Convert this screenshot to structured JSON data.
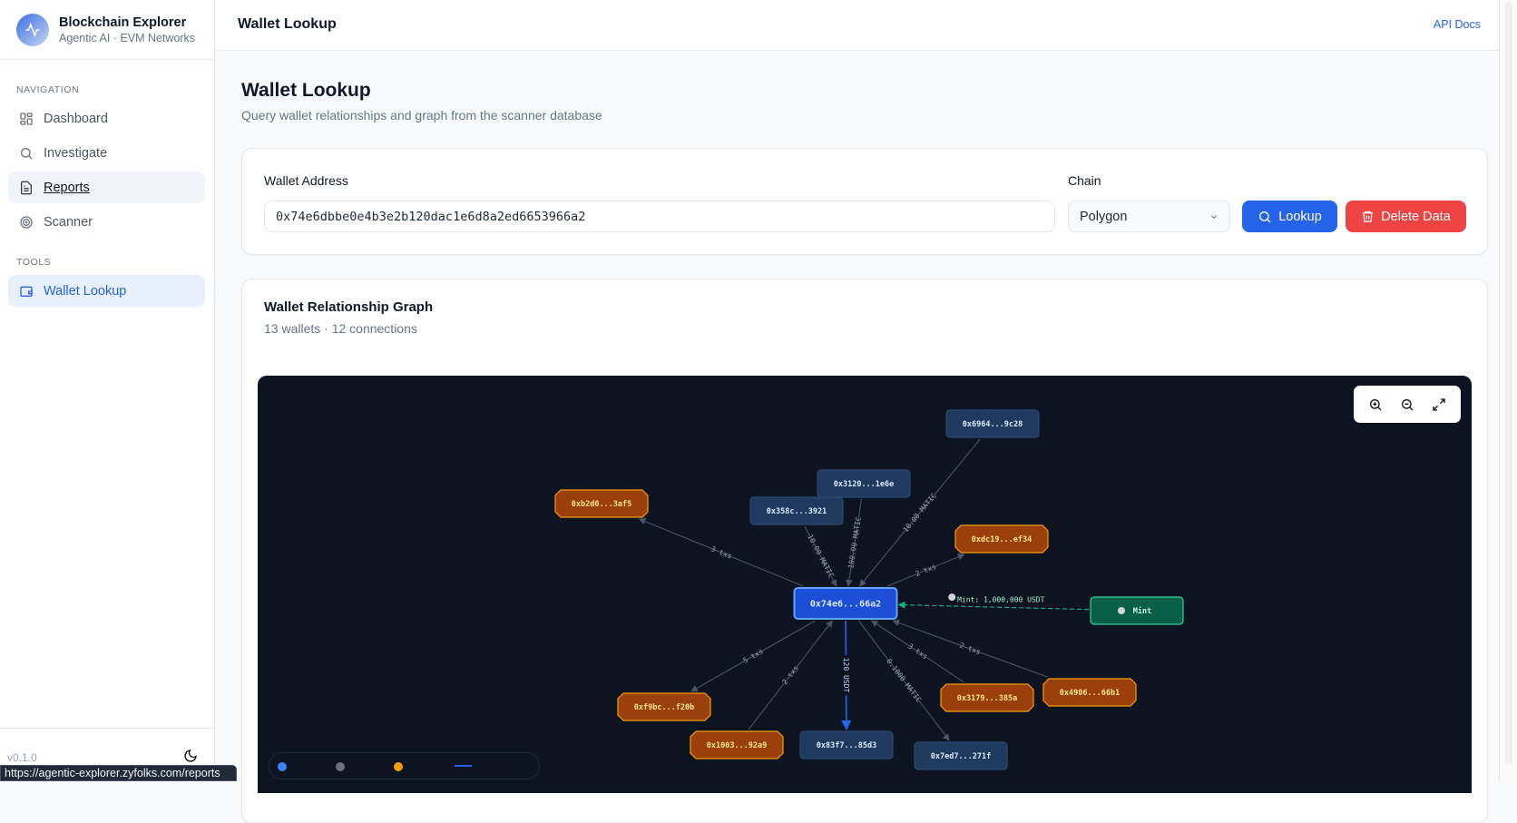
{
  "app": {
    "title": "Blockchain Explorer",
    "subtitle": "Agentic AI · EVM Networks",
    "version": "v0.1.0"
  },
  "sidebar": {
    "sections": [
      {
        "label": "NAVIGATION"
      },
      {
        "label": "TOOLS"
      }
    ],
    "items": [
      {
        "label": "Dashboard",
        "icon": "dashboard-icon"
      },
      {
        "label": "Investigate",
        "icon": "search-icon"
      },
      {
        "label": "Reports",
        "icon": "file-text-icon"
      },
      {
        "label": "Scanner",
        "icon": "radar-icon"
      },
      {
        "label": "Wallet Lookup",
        "icon": "wallet-icon",
        "active": true
      }
    ]
  },
  "status_url": "https://agentic-explorer.zyfolks.com/reports",
  "header": {
    "title": "Wallet Lookup",
    "api_docs": "API Docs"
  },
  "page": {
    "title": "Wallet Lookup",
    "subtitle": "Query wallet relationships and graph from the scanner database"
  },
  "form": {
    "address_label": "Wallet Address",
    "address_value": "0x74e6dbbe0e4b3e2b120dac1e6d8a2ed6653966a2",
    "chain_label": "Chain",
    "chain_value": "Polygon",
    "lookup_label": "Lookup",
    "delete_label": "Delete Data"
  },
  "graph": {
    "title": "Wallet Relationship Graph",
    "summary": "13 wallets · 12 connections",
    "colors": {
      "center": "#1d4ed8",
      "wallet": "#1e3a5f",
      "contract": "#9a3f0b",
      "mint": "#065f46",
      "edge": "#4b5563",
      "usdt_edge": "#2563eb",
      "mint_edge": "#10b981"
    },
    "nodes": [
      {
        "id": "c",
        "label": "0x74e6...66a2",
        "type": "center"
      },
      {
        "id": "n6964",
        "label": "0x6964...9c28",
        "type": "wallet"
      },
      {
        "id": "n3120",
        "label": "0x3120...1e6e",
        "type": "wallet"
      },
      {
        "id": "n358c",
        "label": "0x358c...3921",
        "type": "wallet"
      },
      {
        "id": "nb2d0",
        "label": "0xb2d0...3af5",
        "type": "contract"
      },
      {
        "id": "ndc19",
        "label": "0xdc19...ef34",
        "type": "contract"
      },
      {
        "id": "mint",
        "label": "Mint",
        "type": "mint"
      },
      {
        "id": "nf9bc",
        "label": "0xf9bc...f20b",
        "type": "contract"
      },
      {
        "id": "n1003",
        "label": "0x1003...92a9",
        "type": "contract"
      },
      {
        "id": "n83f7",
        "label": "0x83f7...85d3",
        "type": "wallet"
      },
      {
        "id": "n7ed7",
        "label": "0x7ed7...271f",
        "type": "wallet"
      },
      {
        "id": "n3179",
        "label": "0x3179...385a",
        "type": "contract"
      },
      {
        "id": "n4906",
        "label": "0x4906...66b1",
        "type": "contract"
      }
    ],
    "edges": [
      {
        "from": "c",
        "to": "nb2d0",
        "label": "3 txs"
      },
      {
        "from": "n358c",
        "to": "c",
        "label": "10.00 MATIC"
      },
      {
        "from": "n3120",
        "to": "c",
        "label": "100.00 MATIC"
      },
      {
        "from": "n6964",
        "to": "c",
        "label": "10.00 MATIC"
      },
      {
        "from": "c",
        "to": "ndc19",
        "label": "2 txs"
      },
      {
        "from": "mint",
        "to": "c",
        "label": "Mint: 1,000,000 USDT",
        "style": "mint"
      },
      {
        "from": "c",
        "to": "nf9bc",
        "label": "5 txs"
      },
      {
        "from": "n1003",
        "to": "c",
        "label": "2 txs"
      },
      {
        "from": "c",
        "to": "n83f7",
        "label": "120 USDT",
        "style": "usdt"
      },
      {
        "from": "c",
        "to": "n7ed7",
        "label": "0.1000 MATIC"
      },
      {
        "from": "n3179",
        "to": "c",
        "label": "3 txs"
      },
      {
        "from": "n4906",
        "to": "c",
        "label": "2 txs"
      }
    ],
    "legend": [
      {
        "color": "#3b82f6",
        "kind": "dot"
      },
      {
        "color": "#6b7280",
        "kind": "dot"
      },
      {
        "color": "#f59e0b",
        "kind": "dot"
      },
      {
        "color": "#2563eb",
        "kind": "line"
      }
    ]
  }
}
